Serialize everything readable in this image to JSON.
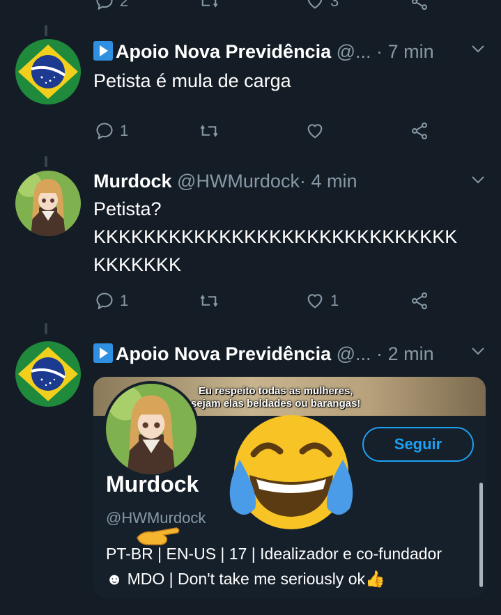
{
  "colors": {
    "background": "#141d26",
    "text_primary": "#ffffff",
    "text_secondary": "#8899a6",
    "accent": "#1da1f2",
    "thread_line": "#38444d"
  },
  "top_actions": {
    "reply_count": "2",
    "like_count": "3"
  },
  "tweets": [
    {
      "name": "Apoio Nova Previdência",
      "handle": "@...",
      "time": "7 min",
      "text": "Petista é mula de carga",
      "reply_count": "1",
      "retweet_count": "",
      "like_count": "",
      "avatar_icon": "brazil-flag-icon"
    },
    {
      "name": "Murdock",
      "handle": "@HWMurdock",
      "time": "4 min",
      "text": "Petista?\nKKKKKKKKKKKKKKKKKKKKKKKKKKKKK\nKKKKKKK",
      "reply_count": "1",
      "retweet_count": "",
      "like_count": "1",
      "avatar_icon": "anime-girl-avatar"
    },
    {
      "name": "Apoio Nova Previdência",
      "handle": "@...",
      "time": "2 min",
      "avatar_icon": "brazil-flag-icon"
    }
  ],
  "dot": "·",
  "embedded_profile": {
    "banner_caption": "Eu respeito todas as mulheres,\nsejam elas beldades ou barangas!",
    "follow_label": "Seguir",
    "name": "Murdock",
    "handle": "@HWMurdock",
    "bio": "PT-BR | EN-US | 17 | Idealizador e co-fundador\n☻ MDO | Don't take me seriously ok👍"
  },
  "overlay_icons": [
    "laughing-tears-emoji-icon",
    "pointing-hand-icon"
  ]
}
